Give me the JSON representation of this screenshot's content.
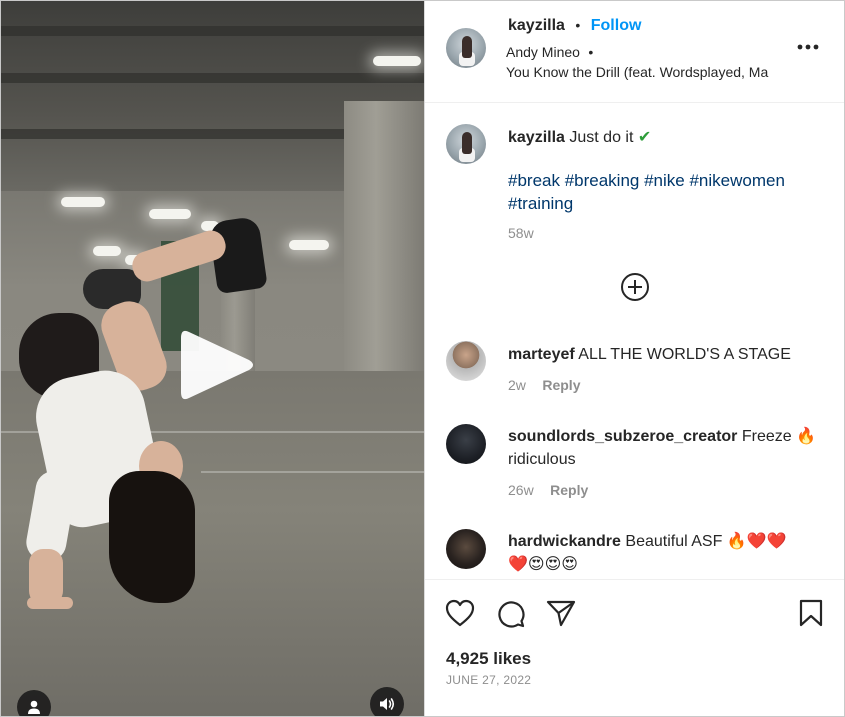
{
  "post_header": {
    "username": "kayzilla",
    "separator": "•",
    "follow_label": "Follow",
    "audio_artist": "Andy Mineo",
    "audio_separator": "•",
    "audio_track": "You Know the Drill (feat. Wordsplayed, Ma",
    "more_icon": "more-horizontal-icon"
  },
  "caption": {
    "username": "kayzilla",
    "text": "Just do it",
    "emoji": "✔",
    "hashtags_line1": "#break #breaking #nike #nikewomen",
    "hashtags_line2": "#training",
    "age": "58w"
  },
  "load_more_icon": "plus-circle-icon",
  "comments": [
    {
      "username": "marteyef",
      "text": "ALL THE WORLD'S A STAGE",
      "age": "2w",
      "reply_label": "Reply"
    },
    {
      "username": "soundlords_subzeroe_creator",
      "text": "Freeze 🔥",
      "text_line2": "ridiculous",
      "age": "26w",
      "reply_label": "Reply"
    },
    {
      "username": "hardwickandre",
      "text": "Beautiful ASF 🔥❤️❤️",
      "text_line2": "❤️😍😍😍"
    }
  ],
  "actions": {
    "like_icon": "heart-icon",
    "comment_icon": "comment-icon",
    "share_icon": "send-icon",
    "save_icon": "bookmark-icon"
  },
  "likes_text": "4,925 likes",
  "date_text": "JUNE 27, 2022",
  "video": {
    "play_icon": "play-icon",
    "user_tags_icon": "user-icon",
    "audio_icon": "speaker-icon"
  },
  "colors": {
    "accent_blue": "#0095f6",
    "hashtag_blue": "#00376b",
    "muted_gray": "#8e8e8e"
  }
}
